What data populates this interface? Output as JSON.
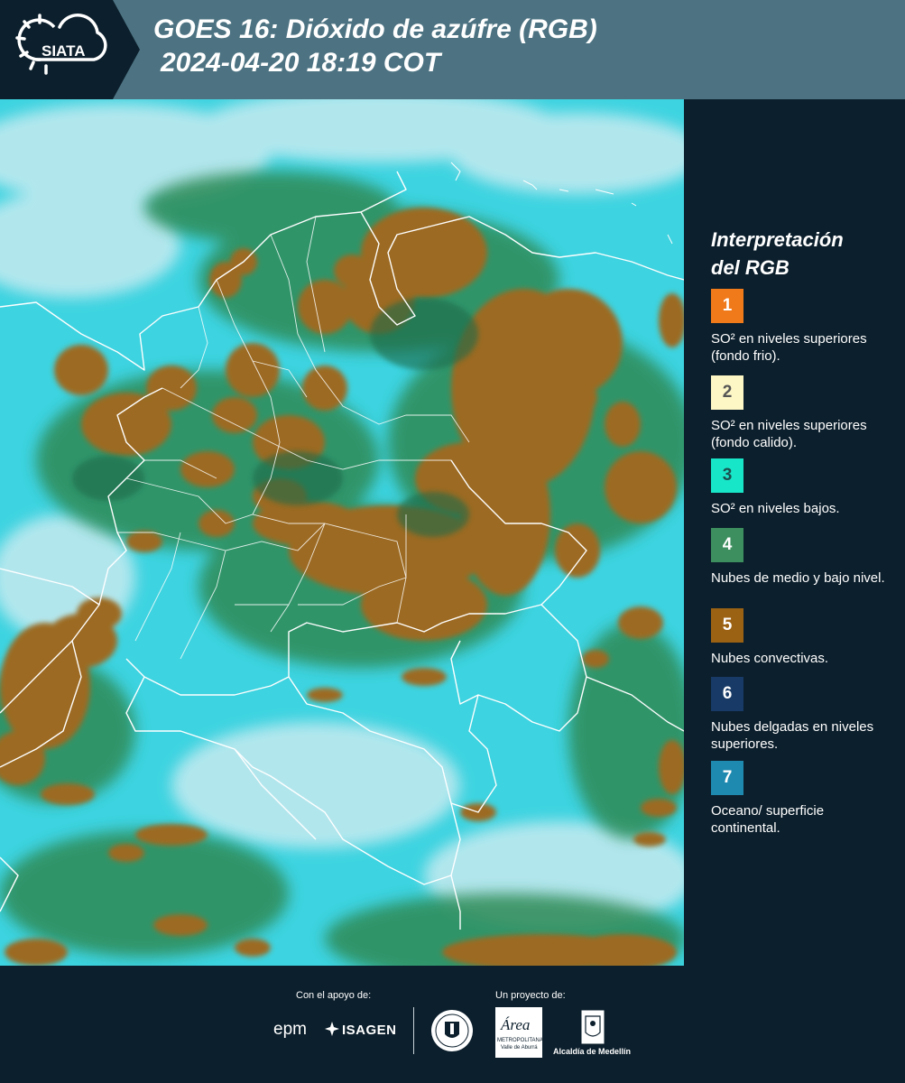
{
  "header": {
    "logo_text": "SIATA",
    "title_line1": "GOES 16: Dióxido de azúfre (RGB)",
    "title_line2": "2024-04-20 18:19 COT"
  },
  "legend": {
    "title_line1": "Interpretación",
    "title_line2": "del RGB",
    "items": [
      {
        "number": "1",
        "color": "#f07a1a",
        "text_color": "#ffffff",
        "label": "SO² en niveles superiores (fondo frio)."
      },
      {
        "number": "2",
        "color": "#fdf7c6",
        "text_color": "#555555",
        "label": "SO² en niveles superiores (fondo calido)."
      },
      {
        "number": "3",
        "color": "#18e6c8",
        "text_color": "#1b4f4f",
        "label": "SO² en niveles bajos."
      },
      {
        "number": "4",
        "color": "#3d8f5f",
        "text_color": "#ffffff",
        "label": "Nubes de medio y bajo nivel."
      },
      {
        "number": "5",
        "color": "#9c6214",
        "text_color": "#ffffff",
        "label": "Nubes convectivas."
      },
      {
        "number": "6",
        "color": "#173a66",
        "text_color": "#ffffff",
        "label": "Nubes delgadas en niveles superiores."
      },
      {
        "number": "7",
        "color": "#1f8ab0",
        "text_color": "#ffffff",
        "label": "Oceano/ superficie continental."
      }
    ]
  },
  "footer": {
    "support_label": "Con el apoyo de:",
    "project_label": "Un proyecto de:",
    "epm_text": "epm",
    "isagen_text": "ISAGEN",
    "area_text": "Área",
    "area_subtitle": "METROPOLITANA",
    "area_subtitle2": "Valle de Aburrá",
    "alcaldia_text": "Alcaldía de Medellín"
  },
  "colors": {
    "header_bg": "#4d7382",
    "dark_bg": "#0c1f2c",
    "ocean_cyan": "#3dd3e0",
    "convective_brown": "#9c6a24",
    "green_cloud": "#2f8a55"
  }
}
